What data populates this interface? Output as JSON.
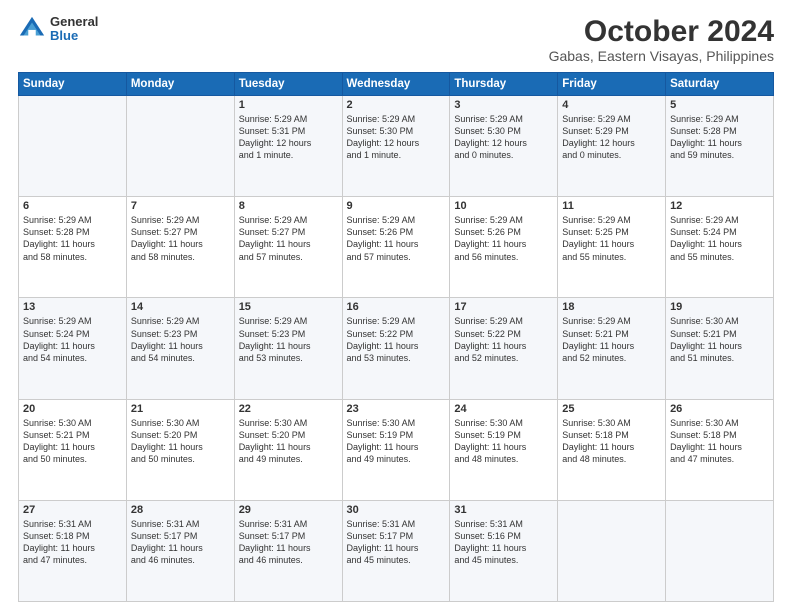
{
  "logo": {
    "general": "General",
    "blue": "Blue"
  },
  "title": "October 2024",
  "subtitle": "Gabas, Eastern Visayas, Philippines",
  "weekdays": [
    "Sunday",
    "Monday",
    "Tuesday",
    "Wednesday",
    "Thursday",
    "Friday",
    "Saturday"
  ],
  "weeks": [
    [
      {
        "day": "",
        "text": ""
      },
      {
        "day": "",
        "text": ""
      },
      {
        "day": "1",
        "text": "Sunrise: 5:29 AM\nSunset: 5:31 PM\nDaylight: 12 hours\nand 1 minute."
      },
      {
        "day": "2",
        "text": "Sunrise: 5:29 AM\nSunset: 5:30 PM\nDaylight: 12 hours\nand 1 minute."
      },
      {
        "day": "3",
        "text": "Sunrise: 5:29 AM\nSunset: 5:30 PM\nDaylight: 12 hours\nand 0 minutes."
      },
      {
        "day": "4",
        "text": "Sunrise: 5:29 AM\nSunset: 5:29 PM\nDaylight: 12 hours\nand 0 minutes."
      },
      {
        "day": "5",
        "text": "Sunrise: 5:29 AM\nSunset: 5:28 PM\nDaylight: 11 hours\nand 59 minutes."
      }
    ],
    [
      {
        "day": "6",
        "text": "Sunrise: 5:29 AM\nSunset: 5:28 PM\nDaylight: 11 hours\nand 58 minutes."
      },
      {
        "day": "7",
        "text": "Sunrise: 5:29 AM\nSunset: 5:27 PM\nDaylight: 11 hours\nand 58 minutes."
      },
      {
        "day": "8",
        "text": "Sunrise: 5:29 AM\nSunset: 5:27 PM\nDaylight: 11 hours\nand 57 minutes."
      },
      {
        "day": "9",
        "text": "Sunrise: 5:29 AM\nSunset: 5:26 PM\nDaylight: 11 hours\nand 57 minutes."
      },
      {
        "day": "10",
        "text": "Sunrise: 5:29 AM\nSunset: 5:26 PM\nDaylight: 11 hours\nand 56 minutes."
      },
      {
        "day": "11",
        "text": "Sunrise: 5:29 AM\nSunset: 5:25 PM\nDaylight: 11 hours\nand 55 minutes."
      },
      {
        "day": "12",
        "text": "Sunrise: 5:29 AM\nSunset: 5:24 PM\nDaylight: 11 hours\nand 55 minutes."
      }
    ],
    [
      {
        "day": "13",
        "text": "Sunrise: 5:29 AM\nSunset: 5:24 PM\nDaylight: 11 hours\nand 54 minutes."
      },
      {
        "day": "14",
        "text": "Sunrise: 5:29 AM\nSunset: 5:23 PM\nDaylight: 11 hours\nand 54 minutes."
      },
      {
        "day": "15",
        "text": "Sunrise: 5:29 AM\nSunset: 5:23 PM\nDaylight: 11 hours\nand 53 minutes."
      },
      {
        "day": "16",
        "text": "Sunrise: 5:29 AM\nSunset: 5:22 PM\nDaylight: 11 hours\nand 53 minutes."
      },
      {
        "day": "17",
        "text": "Sunrise: 5:29 AM\nSunset: 5:22 PM\nDaylight: 11 hours\nand 52 minutes."
      },
      {
        "day": "18",
        "text": "Sunrise: 5:29 AM\nSunset: 5:21 PM\nDaylight: 11 hours\nand 52 minutes."
      },
      {
        "day": "19",
        "text": "Sunrise: 5:30 AM\nSunset: 5:21 PM\nDaylight: 11 hours\nand 51 minutes."
      }
    ],
    [
      {
        "day": "20",
        "text": "Sunrise: 5:30 AM\nSunset: 5:21 PM\nDaylight: 11 hours\nand 50 minutes."
      },
      {
        "day": "21",
        "text": "Sunrise: 5:30 AM\nSunset: 5:20 PM\nDaylight: 11 hours\nand 50 minutes."
      },
      {
        "day": "22",
        "text": "Sunrise: 5:30 AM\nSunset: 5:20 PM\nDaylight: 11 hours\nand 49 minutes."
      },
      {
        "day": "23",
        "text": "Sunrise: 5:30 AM\nSunset: 5:19 PM\nDaylight: 11 hours\nand 49 minutes."
      },
      {
        "day": "24",
        "text": "Sunrise: 5:30 AM\nSunset: 5:19 PM\nDaylight: 11 hours\nand 48 minutes."
      },
      {
        "day": "25",
        "text": "Sunrise: 5:30 AM\nSunset: 5:18 PM\nDaylight: 11 hours\nand 48 minutes."
      },
      {
        "day": "26",
        "text": "Sunrise: 5:30 AM\nSunset: 5:18 PM\nDaylight: 11 hours\nand 47 minutes."
      }
    ],
    [
      {
        "day": "27",
        "text": "Sunrise: 5:31 AM\nSunset: 5:18 PM\nDaylight: 11 hours\nand 47 minutes."
      },
      {
        "day": "28",
        "text": "Sunrise: 5:31 AM\nSunset: 5:17 PM\nDaylight: 11 hours\nand 46 minutes."
      },
      {
        "day": "29",
        "text": "Sunrise: 5:31 AM\nSunset: 5:17 PM\nDaylight: 11 hours\nand 46 minutes."
      },
      {
        "day": "30",
        "text": "Sunrise: 5:31 AM\nSunset: 5:17 PM\nDaylight: 11 hours\nand 45 minutes."
      },
      {
        "day": "31",
        "text": "Sunrise: 5:31 AM\nSunset: 5:16 PM\nDaylight: 11 hours\nand 45 minutes."
      },
      {
        "day": "",
        "text": ""
      },
      {
        "day": "",
        "text": ""
      }
    ]
  ]
}
